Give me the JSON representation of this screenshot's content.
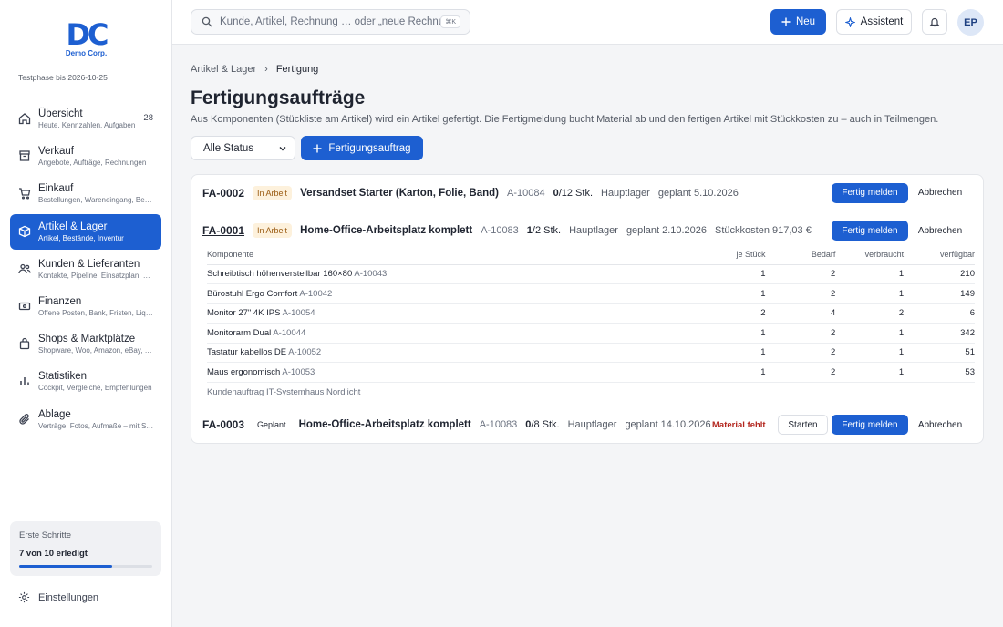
{
  "brand": {
    "logo_text": "Demo Corp.",
    "trial": "Testphase bis 2026-10-25"
  },
  "colors": {
    "accent": "#1d5fd1",
    "warn": "#b3261e",
    "badge_work_bg": "#fdf1dc"
  },
  "sidebar": {
    "items": [
      {
        "title": "Übersicht",
        "sub": "Heute, Kennzahlen, Aufgaben",
        "badge": "28",
        "icon": "home-icon"
      },
      {
        "title": "Verkauf",
        "sub": "Angebote, Aufträge, Rechnungen",
        "icon": "archive-icon"
      },
      {
        "title": "Einkauf",
        "sub": "Bestellungen, Wareneingang, Bestand",
        "icon": "cart-icon"
      },
      {
        "title": "Artikel & Lager",
        "sub": "Artikel, Bestände, Inventur",
        "icon": "box-icon"
      },
      {
        "title": "Kunden & Lieferanten",
        "sub": "Kontakte, Pipeline, Einsatzplan, Leads",
        "icon": "users-icon"
      },
      {
        "title": "Finanzen",
        "sub": "Offene Posten, Bank, Fristen, Liquidität",
        "icon": "wallet-icon"
      },
      {
        "title": "Shops & Marktplätze",
        "sub": "Shopware, Woo, Amazon, eBay, Kaufland",
        "icon": "shop-icon"
      },
      {
        "title": "Statistiken",
        "sub": "Cockpit, Vergleiche, Empfehlungen",
        "icon": "bar-chart-icon"
      },
      {
        "title": "Ablage",
        "sub": "Verträge, Fotos, Aufmaße – mit Suche",
        "icon": "paperclip-icon"
      }
    ],
    "onboarding": {
      "title": "Erste Schritte",
      "status": "7 von 10 erledigt",
      "progress": 0.7
    },
    "settings_label": "Einstellungen"
  },
  "topbar": {
    "search_placeholder": "Kunde, Artikel, Rechnung … oder „neue Rechnung“",
    "shortcut": "⌘K",
    "new_label": "Neu",
    "assistant_label": "Assistent",
    "avatar_initials": "EP"
  },
  "breadcrumb": {
    "parent": "Artikel & Lager",
    "current": "Fertigung"
  },
  "page": {
    "title": "Fertigungsaufträge",
    "description": "Aus Komponenten (Stückliste am Artikel) wird ein Artikel gefertigt. Die Fertigmeldung bucht Material ab und den fertigen Artikel mit Stückkosten zu – auch in Teilmengen.",
    "status_filter": "Alle Status",
    "create_label": "Fertigungsauftrag"
  },
  "orders": [
    {
      "id": "FA-0002",
      "status": "In Arbeit",
      "name": "Versandset Starter (Karton, Folie, Band)",
      "sku": "A-10084",
      "qty_done": "0",
      "qty_total": "/12 Stk.",
      "warehouse": "Hauptlager",
      "planned": "geplant 5.10.2026",
      "finish_label": "Fertig melden",
      "cancel_label": "Abbrechen"
    },
    {
      "id": "FA-0001",
      "status": "In Arbeit",
      "name": "Home-Office-Arbeitsplatz komplett",
      "sku": "A-10083",
      "qty_done": "1",
      "qty_total": "/2 Stk.",
      "warehouse": "Hauptlager",
      "planned": "geplant 2.10.2026",
      "unit_cost": "Stückkosten 917,03 €",
      "finish_label": "Fertig melden",
      "cancel_label": "Abbrechen"
    },
    {
      "id": "FA-0003",
      "status": "Geplant",
      "name": "Home-Office-Arbeitsplatz komplett",
      "sku": "A-10083",
      "qty_done": "0",
      "qty_total": "/8 Stk.",
      "warehouse": "Hauptlager",
      "planned": "geplant 14.10.2026",
      "warning": "Material fehlt",
      "start_label": "Starten",
      "finish_label": "Fertig melden",
      "cancel_label": "Abbrechen"
    }
  ],
  "components": {
    "headers": [
      "Komponente",
      "je Stück",
      "Bedarf",
      "verbraucht",
      "verfügbar"
    ],
    "rows": [
      {
        "name": "Schreibtisch höhenverstellbar 160×80",
        "sku": "A-10043",
        "per_unit": "1",
        "need": "2",
        "used": "1",
        "avail": "210"
      },
      {
        "name": "Bürostuhl Ergo Comfort",
        "sku": "A-10042",
        "per_unit": "1",
        "need": "2",
        "used": "1",
        "avail": "149"
      },
      {
        "name": "Monitor 27\" 4K IPS",
        "sku": "A-10054",
        "per_unit": "2",
        "need": "4",
        "used": "2",
        "avail": "6"
      },
      {
        "name": "Monitorarm Dual",
        "sku": "A-10044",
        "per_unit": "1",
        "need": "2",
        "used": "1",
        "avail": "342"
      },
      {
        "name": "Tastatur kabellos DE",
        "sku": "A-10052",
        "per_unit": "1",
        "need": "2",
        "used": "1",
        "avail": "51"
      },
      {
        "name": "Maus ergonomisch",
        "sku": "A-10053",
        "per_unit": "1",
        "need": "2",
        "used": "1",
        "avail": "53"
      }
    ],
    "footer": "Kundenauftrag IT-Systemhaus Nordlicht"
  }
}
